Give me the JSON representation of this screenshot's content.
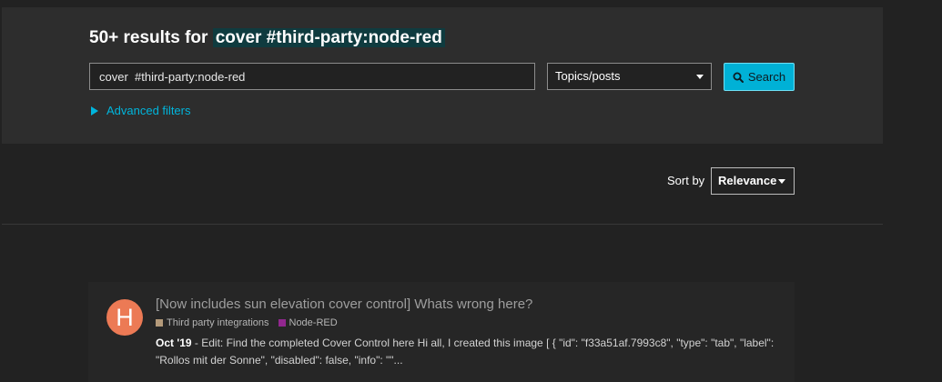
{
  "header": {
    "heading_prefix": "50+ results for",
    "heading_term": "cover #third-party:node-red",
    "search_value": "cover  #third-party:node-red",
    "type_select_value": "Topics/posts",
    "search_button_label": "Search",
    "advanced_filters_label": "Advanced filters"
  },
  "sort": {
    "label": "Sort by",
    "value": "Relevance"
  },
  "results": [
    {
      "avatar_letter": "H",
      "avatar_color": "#ec7a55",
      "title": "[Now includes sun elevation cover control] Whats wrong here?",
      "categories": [
        {
          "name": "Third party integrations",
          "color": "#b49a7a"
        },
        {
          "name": "Node-RED",
          "color": "#92278f"
        }
      ],
      "date": "Oct '19",
      "blurb": "- Edit: Find the completed Cover Control here Hi all, I created this image [ { \"id\": \"f33a51af.7993c8\", \"type\": \"tab\", \"label\": \"Rollos mit der Sonne\", \"disabled\": false, \"info\": \"\"..."
    }
  ],
  "colors": {
    "accent": "#00b1d6",
    "highlight": "#0f3b3f",
    "background": "#222222",
    "panel": "#2d2d2d"
  }
}
